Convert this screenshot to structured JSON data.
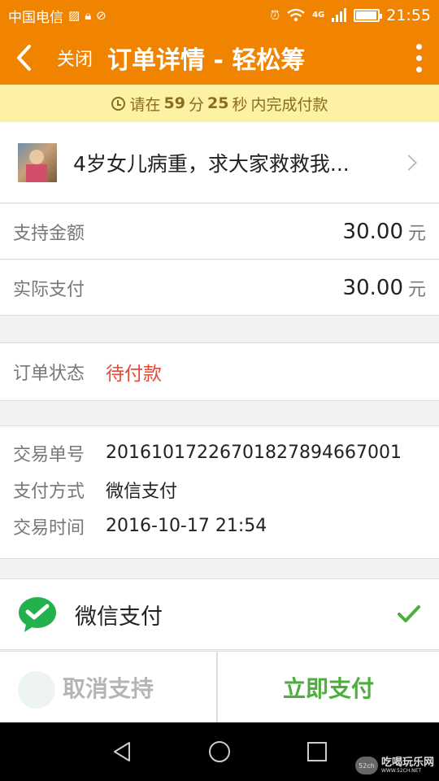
{
  "status_bar": {
    "carrier": "中国电信",
    "network": "4G",
    "time": "21:55",
    "battery_level": 0.9
  },
  "app_bar": {
    "close_label": "关闭",
    "title": "订单详情 - 轻松筹"
  },
  "notice": {
    "prefix": "请在",
    "minutes": "59",
    "minutes_unit": "分",
    "seconds": "25",
    "seconds_unit": "秒",
    "suffix": "内完成付款"
  },
  "project": {
    "title": "4岁女儿病重，求大家救救我..."
  },
  "amounts": {
    "support_label": "支持金额",
    "support_value": "30.00",
    "actual_label": "实际支付",
    "actual_value": "30.00",
    "unit": "元"
  },
  "order_status": {
    "label": "订单状态",
    "value": "待付款"
  },
  "transaction": {
    "number_label": "交易单号",
    "number_value": "20161017226701827894667001",
    "method_label": "支付方式",
    "method_value": "微信支付",
    "time_label": "交易时间",
    "time_value": "2016-10-17 21:54"
  },
  "payment_option": {
    "label": "微信支付",
    "selected": true
  },
  "actions": {
    "cancel_label": "取消支持",
    "pay_label": "立即支付"
  },
  "watermark": {
    "logo": "52ch",
    "name": "吃喝玩乐网",
    "url": "WWW.52CH.NET"
  },
  "colors": {
    "brand_orange": "#f08300",
    "notice_bg": "#fdf2a3",
    "status_red": "#e04b3a",
    "pay_green": "#4caf3c"
  }
}
